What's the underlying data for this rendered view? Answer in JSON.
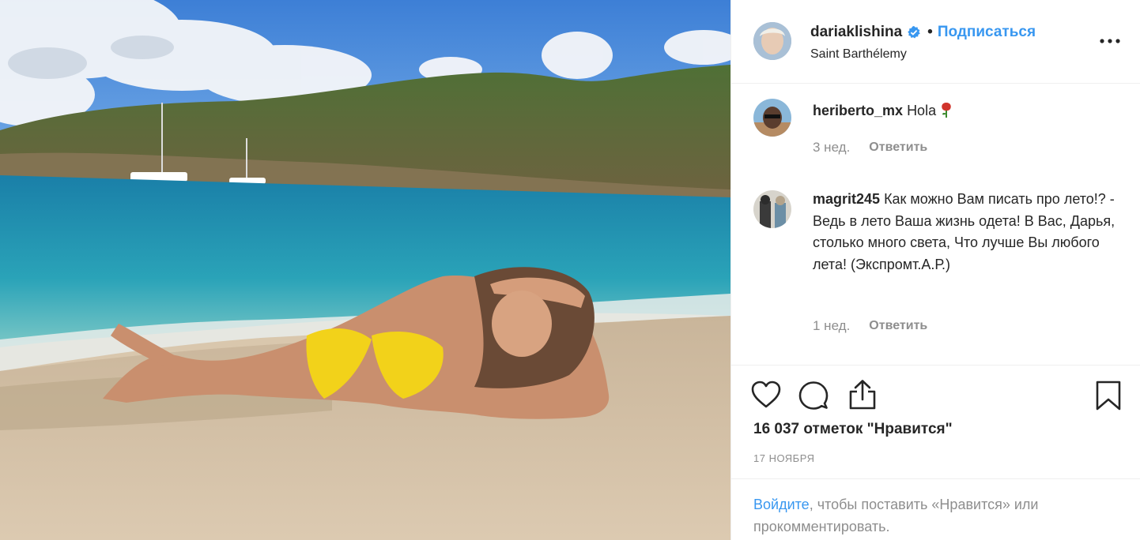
{
  "post": {
    "author": {
      "username": "dariaklishina",
      "verified_icon": "verified-badge-icon",
      "follow_label": "Подписаться",
      "separator": "•",
      "location": "Saint Barthélemy"
    },
    "comments": [
      {
        "user": "heriberto_mx",
        "text": "Hola",
        "emoji_icon": "rose-icon",
        "age": "3 нед.",
        "reply_label": "Ответить"
      },
      {
        "user": "magrit245",
        "text": "Как можно Вам писать про лето!? - Ведь в лето Ваша жизнь одета! В Вас, Дарья, столько много света, Что лучше Вы любого лета! (Экспромт.А.Р.)",
        "age": "1 нед.",
        "reply_label": "Ответить"
      }
    ],
    "likes_text": "16 037 отметок \"Нравится\"",
    "date": "17 НОЯБРЯ",
    "login_prompt": {
      "link": "Войдите",
      "rest": ", чтобы поставить «Нравится» или прокомментировать."
    },
    "icons": {
      "like": "heart-icon",
      "comment": "comment-icon",
      "share": "share-icon",
      "save": "bookmark-icon",
      "more": "more-options-icon"
    },
    "colors": {
      "accent": "#3897f0",
      "muted": "#8e8e8e",
      "text": "#262626",
      "border": "#efefef"
    }
  }
}
